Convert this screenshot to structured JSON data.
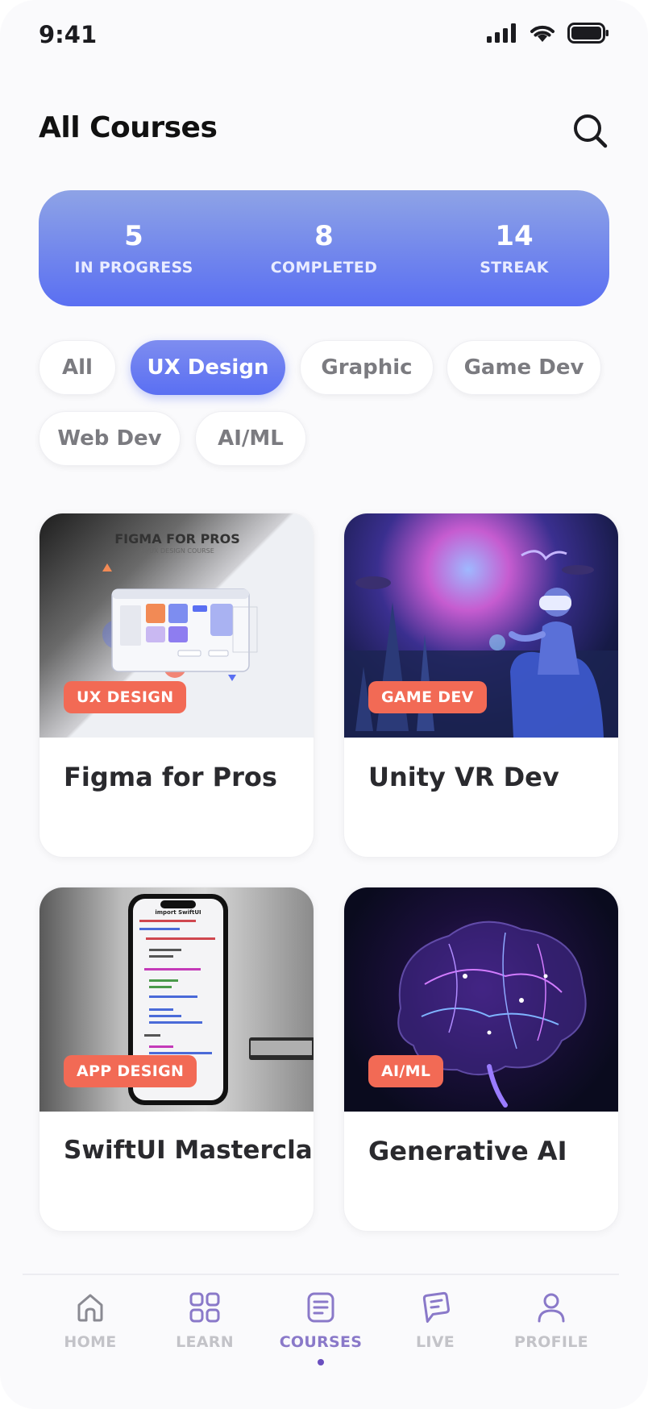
{
  "status_bar": {
    "time": "9:41"
  },
  "header": {
    "title": "All Courses"
  },
  "stats": [
    {
      "value": "5",
      "label": "IN PROGRESS"
    },
    {
      "value": "8",
      "label": "COMPLETED"
    },
    {
      "value": "14",
      "label": "STREAK"
    }
  ],
  "filters": {
    "items": [
      "All",
      "UX Design",
      "Graphic",
      "Game Dev",
      "Web Dev",
      "AI/ML"
    ],
    "selected": "UX Design"
  },
  "courses": [
    {
      "title": "Figma for Pros",
      "category": "UX DESIGN",
      "thumb_title": "FIGMA FOR PROS",
      "thumb_subtitle": "UI/UX DESIGN COURSE"
    },
    {
      "title": "Unity VR Dev",
      "category": "GAME DEV"
    },
    {
      "title": "SwiftUI Masterclass",
      "category": "APP DESIGN",
      "thumb_code_header": "import SwiftUI"
    },
    {
      "title": "Generative AI",
      "category": "AI/ML"
    }
  ],
  "nav": {
    "items": [
      {
        "label": "HOME",
        "icon": "home-icon"
      },
      {
        "label": "LEARN",
        "icon": "grid-icon"
      },
      {
        "label": "COURSES",
        "icon": "document-icon"
      },
      {
        "label": "LIVE",
        "icon": "chat-icon"
      },
      {
        "label": "PROFILE",
        "icon": "user-icon"
      }
    ],
    "active": "COURSES"
  },
  "colors": {
    "accent": "#5a6ff2",
    "badge": "#f26a55",
    "nav_active": "#8a79c9"
  }
}
